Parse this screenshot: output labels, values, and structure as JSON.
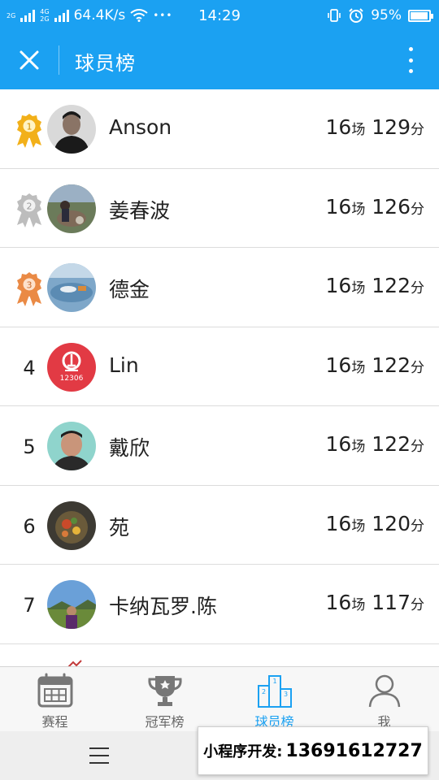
{
  "status_bar": {
    "net_type_1": "2G",
    "net_type_2": "4G",
    "net_type_3": "2G",
    "speed": "64.4K/s",
    "more": "•••",
    "time": "14:29",
    "battery": "95%"
  },
  "header": {
    "title": "球员榜"
  },
  "players": [
    {
      "rank": "1",
      "name": "Anson",
      "games": "16",
      "games_unit": "场",
      "points": "129",
      "points_unit": "分"
    },
    {
      "rank": "2",
      "name": "姜春波",
      "games": "16",
      "games_unit": "场",
      "points": "126",
      "points_unit": "分"
    },
    {
      "rank": "3",
      "name": "德金",
      "games": "16",
      "games_unit": "场",
      "points": "122",
      "points_unit": "分"
    },
    {
      "rank": "4",
      "name": "Lin",
      "games": "16",
      "games_unit": "场",
      "points": "122",
      "points_unit": "分"
    },
    {
      "rank": "5",
      "name": "戴欣",
      "games": "16",
      "games_unit": "场",
      "points": "122",
      "points_unit": "分"
    },
    {
      "rank": "6",
      "name": "苑",
      "games": "16",
      "games_unit": "场",
      "points": "120",
      "points_unit": "分"
    },
    {
      "rank": "7",
      "name": "卡纳瓦罗.陈",
      "games": "16",
      "games_unit": "场",
      "points": "117",
      "points_unit": "分"
    }
  ],
  "avatar_text": {
    "lin_logo": "12306"
  },
  "tabs": [
    {
      "label": "赛程",
      "icon": "calendar-icon",
      "active": false
    },
    {
      "label": "冠军榜",
      "icon": "trophy-icon",
      "active": false
    },
    {
      "label": "球员榜",
      "icon": "podium-icon",
      "active": true
    },
    {
      "label": "我",
      "icon": "user-icon",
      "active": false
    }
  ],
  "podium_numbers": [
    "1",
    "2",
    "3"
  ],
  "ad_banner": {
    "label": "小程序开发:",
    "phone": "13691612727"
  },
  "colors": {
    "brand": "#1ba1f2",
    "gold": "#f2b019",
    "silver": "#bdbdbd",
    "bronze": "#ea8a45",
    "tab_inactive": "#777777"
  }
}
